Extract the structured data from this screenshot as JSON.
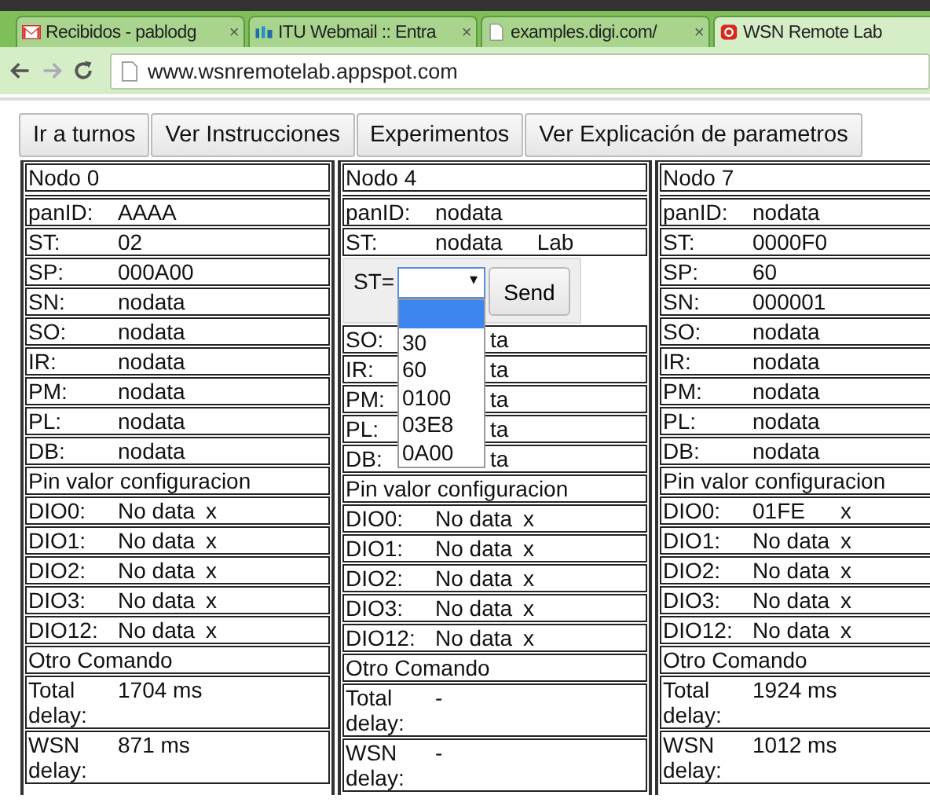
{
  "browser": {
    "tabs": [
      {
        "title": "Recibidos - pablodg",
        "close": "×",
        "selected": false
      },
      {
        "title": "ITU Webmail :: Entra",
        "close": "×",
        "selected": false
      },
      {
        "title": "examples.digi.com/",
        "close": "×",
        "selected": false
      },
      {
        "title": "WSN Remote Lab",
        "selected": true
      }
    ],
    "address": "www.wsnremotelab.appspot.com"
  },
  "buttons": [
    "Ir a turnos",
    "Ver Instrucciones",
    "Experimentos",
    "Ver Explicación de parametros"
  ],
  "nodes": [
    {
      "title": "Nodo 0",
      "params": [
        {
          "name": "panID:",
          "value": "AAAA"
        },
        {
          "name": "ST:",
          "value": "02"
        },
        {
          "name": "SP:",
          "value": "000A00"
        },
        {
          "name": "SN:",
          "value": "nodata"
        },
        {
          "name": "SO:",
          "value": "nodata"
        },
        {
          "name": "IR:",
          "value": "nodata"
        },
        {
          "name": "PM:",
          "value": "nodata"
        },
        {
          "name": "PL:",
          "value": "nodata"
        },
        {
          "name": "DB:",
          "value": "nodata"
        }
      ],
      "pins_title": "Pin valor configuracion",
      "pins": [
        {
          "name": "DIO0:",
          "value": "No data",
          "action": "x"
        },
        {
          "name": "DIO1:",
          "value": "No data",
          "action": "x"
        },
        {
          "name": "DIO2:",
          "value": "No data",
          "action": "x"
        },
        {
          "name": "DIO3:",
          "value": "No data",
          "action": "x"
        },
        {
          "name": "DIO12:",
          "value": "No data",
          "action": "x"
        }
      ],
      "other": "Otro Comando",
      "delays": [
        {
          "name": "Total delay:",
          "value": "1704 ms"
        },
        {
          "name": "WSN delay:",
          "value": "871 ms"
        }
      ]
    },
    {
      "title": "Nodo 4",
      "params": [
        {
          "name": "panID:",
          "value": "nodata"
        },
        {
          "name": "ST:",
          "value": "nodata",
          "extra": "Lab"
        }
      ],
      "popup": {
        "label": "ST=",
        "caret": "▾",
        "button": "Send",
        "options": [
          {
            "selected": true
          },
          {
            "label": "30",
            "selected": false
          },
          {
            "label": "60",
            "selected": false
          },
          {
            "label": "0100",
            "selected": false
          },
          {
            "label": "03E8",
            "selected": false
          },
          {
            "label": "0A00",
            "selected": false
          }
        ]
      },
      "params_after": [
        {
          "name": "SO:",
          "value": "ta",
          "covered": true
        },
        {
          "name": "IR:",
          "value": "ta",
          "covered": true
        },
        {
          "name": "PM:",
          "value": "ta",
          "covered": true
        },
        {
          "name": "PL:",
          "value": "ta",
          "covered": true
        },
        {
          "name": "DB:",
          "value": "ta",
          "covered": true
        }
      ],
      "pins_title": "Pin valor configuracion",
      "pins": [
        {
          "name": "DIO0:",
          "value": "No data",
          "action": "x"
        },
        {
          "name": "DIO1:",
          "value": "No data",
          "action": "x"
        },
        {
          "name": "DIO2:",
          "value": "No data",
          "action": "x"
        },
        {
          "name": "DIO3:",
          "value": "No data",
          "action": "x"
        },
        {
          "name": "DIO12:",
          "value": "No data",
          "action": "x"
        }
      ],
      "other": "Otro Comando",
      "delays": [
        {
          "name": "Total delay:",
          "value": "-"
        },
        {
          "name": "WSN delay:",
          "value": "-"
        }
      ]
    },
    {
      "title": "Nodo 7",
      "params": [
        {
          "name": "panID:",
          "value": "nodata"
        },
        {
          "name": "ST:",
          "value": "0000F0"
        },
        {
          "name": "SP:",
          "value": "60"
        },
        {
          "name": "SN:",
          "value": "000001"
        },
        {
          "name": "SO:",
          "value": "nodata"
        },
        {
          "name": "IR:",
          "value": "nodata"
        },
        {
          "name": "PM:",
          "value": "nodata"
        },
        {
          "name": "PL:",
          "value": "nodata"
        },
        {
          "name": "DB:",
          "value": "nodata"
        }
      ],
      "pins_title": "Pin valor configuracion",
      "pins": [
        {
          "name": "DIO0:",
          "value": "01FE",
          "action": "x"
        },
        {
          "name": "DIO1:",
          "value": "No data",
          "action": "x"
        },
        {
          "name": "DIO2:",
          "value": "No data",
          "action": "x"
        },
        {
          "name": "DIO3:",
          "value": "No data",
          "action": "x"
        },
        {
          "name": "DIO12:",
          "value": "No data",
          "action": "x"
        }
      ],
      "other": "Otro Comando",
      "delays": [
        {
          "name": "Total delay:",
          "value": "1924 ms"
        },
        {
          "name": "WSN delay:",
          "value": "1012 ms"
        }
      ]
    }
  ]
}
